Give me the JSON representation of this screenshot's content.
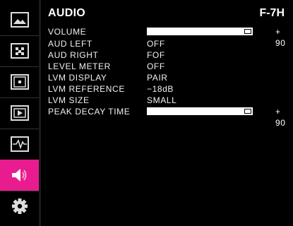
{
  "header": {
    "title": "AUDIO",
    "model": "F-7H"
  },
  "sidebar": {
    "items": [
      {
        "icon": "picture-icon"
      },
      {
        "icon": "dots-icon"
      },
      {
        "icon": "frame-marker-icon"
      },
      {
        "icon": "film-icon"
      },
      {
        "icon": "waveform-icon"
      },
      {
        "icon": "speaker-icon",
        "active": true
      },
      {
        "icon": "gear-icon"
      }
    ]
  },
  "menu": {
    "volume": {
      "label": "VOLUME",
      "value_text": "+ 90",
      "level_percent": 90
    },
    "aud_left": {
      "label": "AUD LEFT",
      "value": "OFF"
    },
    "aud_right": {
      "label": "AUD RIGHT",
      "value": "FOF"
    },
    "level_meter": {
      "label": "LEVEL METER",
      "value": "OFF"
    },
    "lvm_display": {
      "label": "LVM DISPLAY",
      "value": "PAIR"
    },
    "lvm_reference": {
      "label": "LVM REFERENCE",
      "value": "−18dB"
    },
    "lvm_size": {
      "label": "LVM SIZE",
      "value": "SMALL"
    },
    "peak_decay_time": {
      "label": "PEAK DECAY TIME",
      "value_text": "+ 90",
      "level_percent": 90
    }
  },
  "colors": {
    "accent": "#e81c8f",
    "background": "#000000",
    "text": "#ffffff"
  }
}
